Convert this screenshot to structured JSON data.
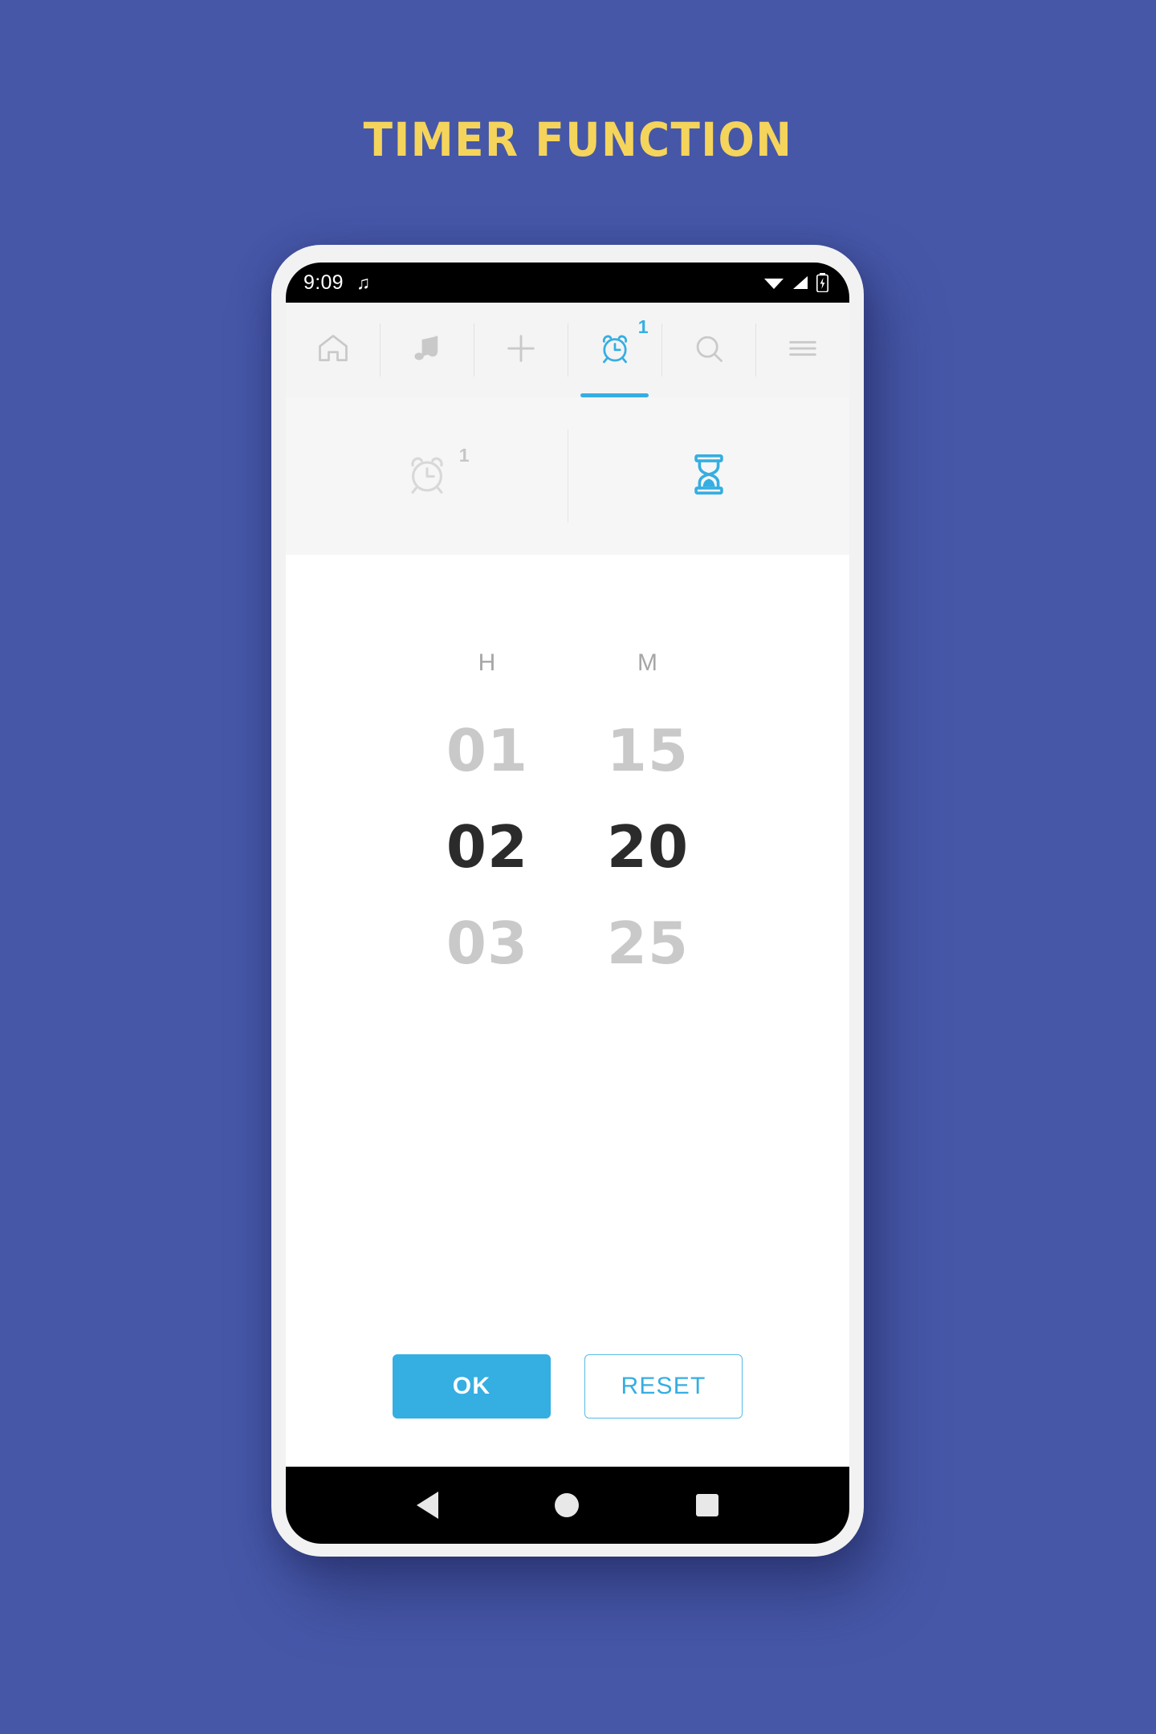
{
  "poster": {
    "title": "TIMER FUNCTION",
    "background_color": "#4657a8",
    "title_color": "#f5d45c"
  },
  "theme": {
    "accent": "#35aee2",
    "inactive_gray": "#c9c9c9",
    "selected_text": "#2b2b2b"
  },
  "status_bar": {
    "time": "9:09",
    "music_icon": "music-note-icon",
    "wifi_icon": "wifi-icon",
    "signal_icon": "cellular-signal-icon",
    "battery_icon": "battery-icon"
  },
  "topnav": {
    "items": [
      {
        "icon": "home-icon",
        "active": false,
        "badge": null
      },
      {
        "icon": "music-note-icon",
        "active": false,
        "badge": null
      },
      {
        "icon": "plus-icon",
        "active": false,
        "badge": null
      },
      {
        "icon": "alarm-clock-icon",
        "active": true,
        "badge": "1"
      },
      {
        "icon": "search-icon",
        "active": false,
        "badge": null
      },
      {
        "icon": "hamburger-menu-icon",
        "active": false,
        "badge": null
      }
    ]
  },
  "subtabs": {
    "items": [
      {
        "icon": "alarm-clock-icon",
        "active": false,
        "badge": "1"
      },
      {
        "icon": "hourglass-icon",
        "active": true,
        "badge": null
      }
    ]
  },
  "picker": {
    "columns": [
      {
        "label": "H",
        "values": [
          "01",
          "02",
          "03"
        ],
        "selected_index": 1,
        "selected_value": "02"
      },
      {
        "label": "M",
        "values": [
          "15",
          "20",
          "25"
        ],
        "selected_index": 1,
        "selected_value": "20"
      }
    ]
  },
  "actions": {
    "ok_label": "OK",
    "reset_label": "RESET"
  },
  "android_nav": {
    "back": "back-triangle-icon",
    "home": "home-circle-icon",
    "recents": "recents-square-icon"
  }
}
